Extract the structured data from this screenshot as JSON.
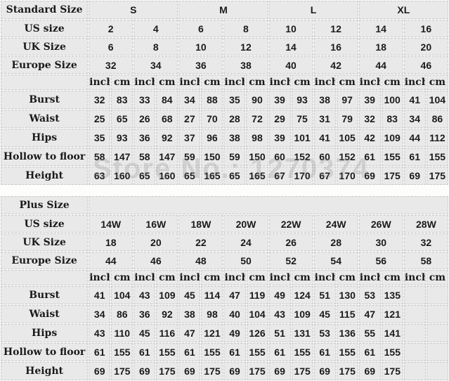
{
  "watermark": "Store No.: 1270374",
  "colors": {
    "header_purple": "#9a9aff",
    "size_cyan": "#c9f7f7",
    "label_green": "#c8f5c8",
    "data_gray": "#e9e9e9",
    "page_bg": "#fdfdfb"
  },
  "units": [
    "inch",
    "cm"
  ],
  "standard": {
    "title": "Standard Size",
    "groups": [
      "S",
      "M",
      "L",
      "XL"
    ],
    "row_labels": {
      "us": "US size",
      "uk": "UK Size",
      "eu": "Europe Size"
    },
    "us_sizes": [
      "2",
      "4",
      "6",
      "8",
      "10",
      "12",
      "14",
      "16"
    ],
    "uk_sizes": [
      "6",
      "8",
      "10",
      "12",
      "14",
      "16",
      "18",
      "20"
    ],
    "eu_sizes": [
      "32",
      "34",
      "36",
      "38",
      "40",
      "42",
      "44",
      "46"
    ],
    "unit_labels": [
      "inch",
      "cm",
      "inch",
      "cm",
      "inch",
      "cm",
      "inch",
      "cm",
      "inch",
      "cm",
      "inch",
      "cm",
      "inch",
      "cm",
      "inch",
      "cm"
    ],
    "measurements": [
      {
        "label": "Burst",
        "values": [
          "32",
          "83",
          "33",
          "84",
          "34",
          "88",
          "35",
          "90",
          "39",
          "93",
          "38",
          "97",
          "39",
          "100",
          "41",
          "104"
        ]
      },
      {
        "label": "Waist",
        "values": [
          "25",
          "65",
          "26",
          "68",
          "27",
          "70",
          "28",
          "72",
          "29",
          "75",
          "31",
          "79",
          "32",
          "83",
          "34",
          "86"
        ]
      },
      {
        "label": "Hips",
        "values": [
          "35",
          "93",
          "36",
          "92",
          "37",
          "96",
          "38",
          "98",
          "39",
          "101",
          "41",
          "105",
          "42",
          "109",
          "44",
          "112"
        ]
      },
      {
        "label": "Hollow to floor",
        "values": [
          "58",
          "147",
          "58",
          "147",
          "59",
          "150",
          "59",
          "150",
          "60",
          "152",
          "60",
          "152",
          "61",
          "155",
          "61",
          "155"
        ]
      },
      {
        "label": "Height",
        "values": [
          "63",
          "160",
          "65",
          "160",
          "65",
          "165",
          "65",
          "165",
          "67",
          "170",
          "67",
          "170",
          "69",
          "175",
          "69",
          "175"
        ]
      }
    ]
  },
  "plus": {
    "title": "Plus Size",
    "row_labels": {
      "us": "US size",
      "uk": "UK Size",
      "eu": "Europe Size"
    },
    "us_sizes": [
      "14W",
      "16W",
      "18W",
      "20W",
      "22W",
      "24W",
      "26W",
      "28W"
    ],
    "uk_sizes": [
      "18",
      "20",
      "22",
      "24",
      "26",
      "28",
      "30",
      "32"
    ],
    "eu_sizes": [
      "44",
      "46",
      "48",
      "50",
      "52",
      "54",
      "56",
      "58"
    ],
    "unit_labels": [
      "inch",
      "cm",
      "inch",
      "cm",
      "inch",
      "cm",
      "inch",
      "cm",
      "inch",
      "cm",
      "inch",
      "cm",
      "inch",
      "cm",
      "inch",
      "cm"
    ],
    "measurements": [
      {
        "label": "Burst",
        "values": [
          "41",
          "104",
          "43",
          "109",
          "45",
          "114",
          "47",
          "119",
          "49",
          "124",
          "51",
          "130",
          "53",
          "135",
          "",
          ""
        ]
      },
      {
        "label": "Waist",
        "values": [
          "34",
          "86",
          "36",
          "92",
          "38",
          "98",
          "40",
          "104",
          "43",
          "109",
          "45",
          "115",
          "47",
          "121",
          "",
          ""
        ]
      },
      {
        "label": "Hips",
        "values": [
          "43",
          "110",
          "45",
          "116",
          "47",
          "121",
          "49",
          "126",
          "51",
          "131",
          "53",
          "136",
          "55",
          "141",
          "",
          ""
        ]
      },
      {
        "label": "Hollow to floor",
        "values": [
          "61",
          "155",
          "61",
          "155",
          "61",
          "155",
          "61",
          "155",
          "61",
          "155",
          "61",
          "155",
          "61",
          "155",
          "",
          ""
        ]
      },
      {
        "label": "Height",
        "values": [
          "69",
          "175",
          "69",
          "175",
          "69",
          "175",
          "69",
          "175",
          "69",
          "175",
          "69",
          "175",
          "69",
          "175",
          "",
          ""
        ]
      }
    ]
  }
}
